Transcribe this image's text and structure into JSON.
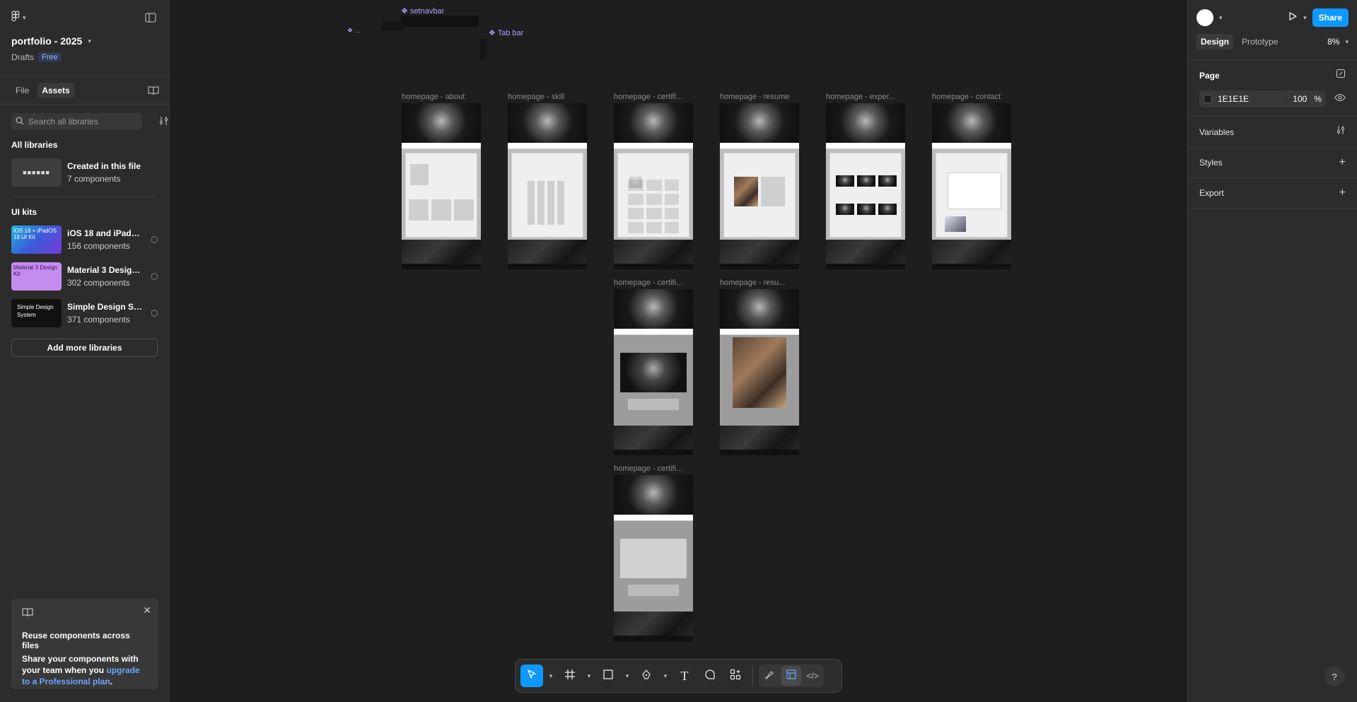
{
  "left": {
    "project_name": "portfolio - 2025",
    "location": "Drafts",
    "plan_badge": "Free",
    "tabs": [
      "File",
      "Assets"
    ],
    "search_placeholder": "Search all libraries",
    "all_libraries_heading": "All libraries",
    "local": {
      "title": "Created in this file",
      "subtitle": "7 components"
    },
    "ui_kits_heading": "UI kits",
    "kits": [
      {
        "title": "iOS 18 and iPadOS ...",
        "subtitle": "156 components",
        "thumb_text": "iOS 18 + iPadOS 18 UI Kit"
      },
      {
        "title": "Material 3 Design Kit",
        "subtitle": "302 components",
        "thumb_text": "Material 3 Design Kit"
      },
      {
        "title": "Simple Design Syst...",
        "subtitle": "371 components",
        "thumb_text": "Simple Design System"
      }
    ],
    "add_libraries": "Add more libraries",
    "promo": {
      "title": "Reuse components across files",
      "body": "Share your components with your team when you ",
      "link": "upgrade to a Professional plan",
      "end": "."
    }
  },
  "canvas": {
    "components": [
      "setnavbar",
      "Tab bar"
    ],
    "frames": [
      {
        "label": "homepage - about"
      },
      {
        "label": "homepage - skill"
      },
      {
        "label": "homepage - certifi..."
      },
      {
        "label": "homepage - resume"
      },
      {
        "label": "homepage - exper..."
      },
      {
        "label": "homepage - contact"
      },
      {
        "label": "homepage - certifi..."
      },
      {
        "label": "homepage - resu..."
      },
      {
        "label": "homepage - certifi..."
      }
    ]
  },
  "right": {
    "share": "Share",
    "tabs": [
      "Design",
      "Prototype"
    ],
    "zoom": "8%",
    "page_heading": "Page",
    "page_color": "1E1E1E",
    "page_opacity": "100",
    "opacity_unit": "%",
    "variables": "Variables",
    "styles": "Styles",
    "export": "Export"
  },
  "colors": {
    "accent": "#0d99ff",
    "canvas_bg": "#1e1e1e",
    "panel_bg": "#2c2c2c",
    "component": "#b79cff"
  },
  "toolbar": {
    "tools": [
      "move-icon",
      "frame-icon",
      "rectangle-icon",
      "pen-icon",
      "text-icon",
      "comment-icon",
      "actions-icon",
      "draw-icon",
      "design-mode-icon",
      "dev-mode-icon"
    ]
  },
  "help": "?"
}
